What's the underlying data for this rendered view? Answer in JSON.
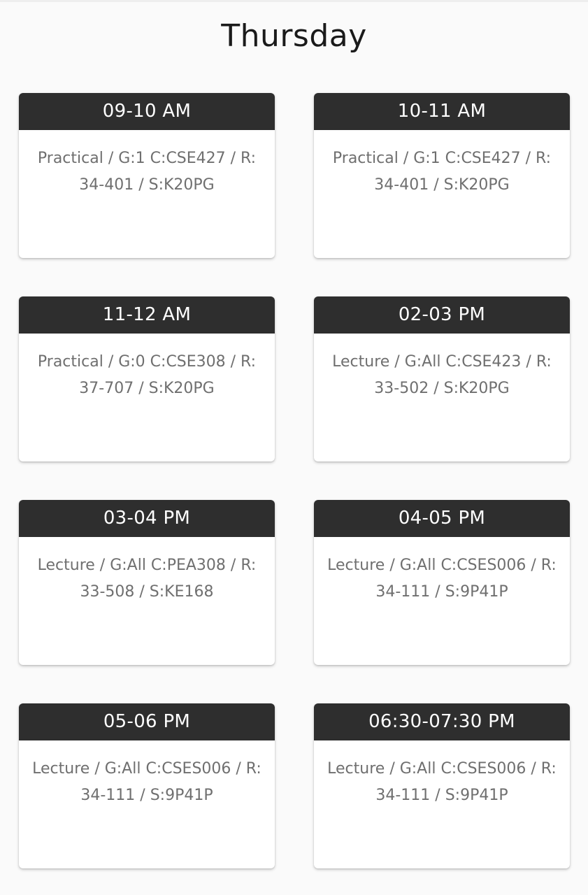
{
  "page": {
    "title": "Thursday"
  },
  "slots": [
    {
      "time": "09-10 AM",
      "details": "Practical / G:1 C:CSE427 / R: 34-401 / S:K20PG"
    },
    {
      "time": "10-11 AM",
      "details": "Practical / G:1 C:CSE427 / R: 34-401 / S:K20PG"
    },
    {
      "time": "11-12 AM",
      "details": "Practical / G:0 C:CSE308 / R: 37-707 / S:K20PG"
    },
    {
      "time": "02-03 PM",
      "details": "Lecture / G:All C:CSE423 / R: 33-502 / S:K20PG"
    },
    {
      "time": "03-04 PM",
      "details": "Lecture / G:All C:PEA308 / R: 33-508 / S:KE168"
    },
    {
      "time": "04-05 PM",
      "details": "Lecture / G:All C:CSES006 / R: 34-111 / S:9P41P"
    },
    {
      "time": "05-06 PM",
      "details": "Lecture / G:All C:CSES006 / R: 34-111 / S:9P41P"
    },
    {
      "time": "06:30-07:30 PM",
      "details": "Lecture / G:All C:CSES006 / R: 34-111 / S:9P41P"
    }
  ]
}
